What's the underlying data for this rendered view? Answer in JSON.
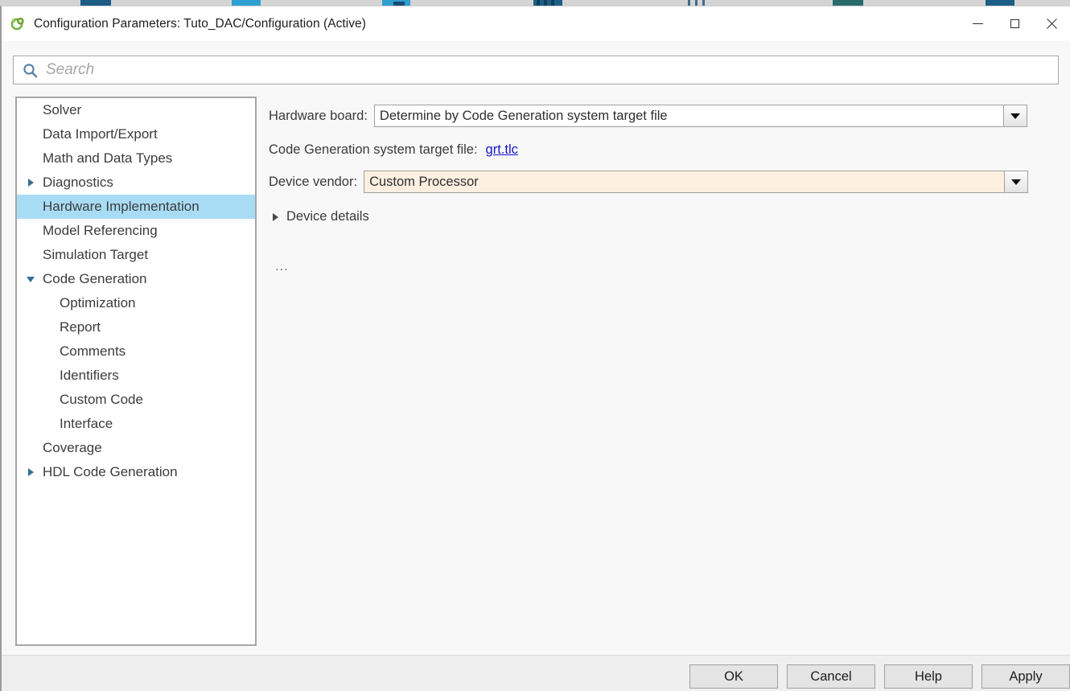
{
  "window": {
    "title": "Configuration Parameters: Tuto_DAC/Configuration (Active)",
    "app_icon": "simulink-gear-icon",
    "controls": {
      "minimize": "minimize-icon",
      "maximize": "maximize-icon",
      "close": "close-icon"
    },
    "accent_selection": "#a8dcf5",
    "modified_field_color": "#fdf0e1",
    "link_color": "#1414cf"
  },
  "search": {
    "placeholder": "Search",
    "value": "",
    "icon": "search-icon"
  },
  "tree": {
    "items": [
      {
        "label": "Solver",
        "level": 0,
        "twisty": "none",
        "selected": false
      },
      {
        "label": "Data Import/Export",
        "level": 0,
        "twisty": "none",
        "selected": false
      },
      {
        "label": "Math and Data Types",
        "level": 0,
        "twisty": "none",
        "selected": false
      },
      {
        "label": "Diagnostics",
        "level": 0,
        "twisty": "collapsed",
        "selected": false
      },
      {
        "label": "Hardware Implementation",
        "level": 0,
        "twisty": "none",
        "selected": true
      },
      {
        "label": "Model Referencing",
        "level": 0,
        "twisty": "none",
        "selected": false
      },
      {
        "label": "Simulation Target",
        "level": 0,
        "twisty": "none",
        "selected": false
      },
      {
        "label": "Code Generation",
        "level": 0,
        "twisty": "expanded",
        "selected": false
      },
      {
        "label": "Optimization",
        "level": 1,
        "twisty": "none",
        "selected": false
      },
      {
        "label": "Report",
        "level": 1,
        "twisty": "none",
        "selected": false
      },
      {
        "label": "Comments",
        "level": 1,
        "twisty": "none",
        "selected": false
      },
      {
        "label": "Identifiers",
        "level": 1,
        "twisty": "none",
        "selected": false
      },
      {
        "label": "Custom Code",
        "level": 1,
        "twisty": "none",
        "selected": false
      },
      {
        "label": "Interface",
        "level": 1,
        "twisty": "none",
        "selected": false
      },
      {
        "label": "Coverage",
        "level": 0,
        "twisty": "none",
        "selected": false
      },
      {
        "label": "HDL Code Generation",
        "level": 0,
        "twisty": "collapsed",
        "selected": false
      }
    ]
  },
  "pane": {
    "hardware_board": {
      "label": "Hardware board:",
      "value": "Determine by Code Generation system target file",
      "modified": false,
      "arrow_icon": "chevron-down-icon"
    },
    "system_target_file": {
      "label": "Code Generation system target file:",
      "link_text": "grt.tlc"
    },
    "device_vendor": {
      "label": "Device vendor:",
      "value": "Custom Processor",
      "modified": true,
      "arrow_icon": "chevron-down-icon"
    },
    "device_details": {
      "label": "Device details",
      "twisty": "collapsed"
    },
    "overflow_text": "..."
  },
  "buttons": {
    "ok": "OK",
    "cancel": "Cancel",
    "help": "Help",
    "apply": "Apply"
  }
}
